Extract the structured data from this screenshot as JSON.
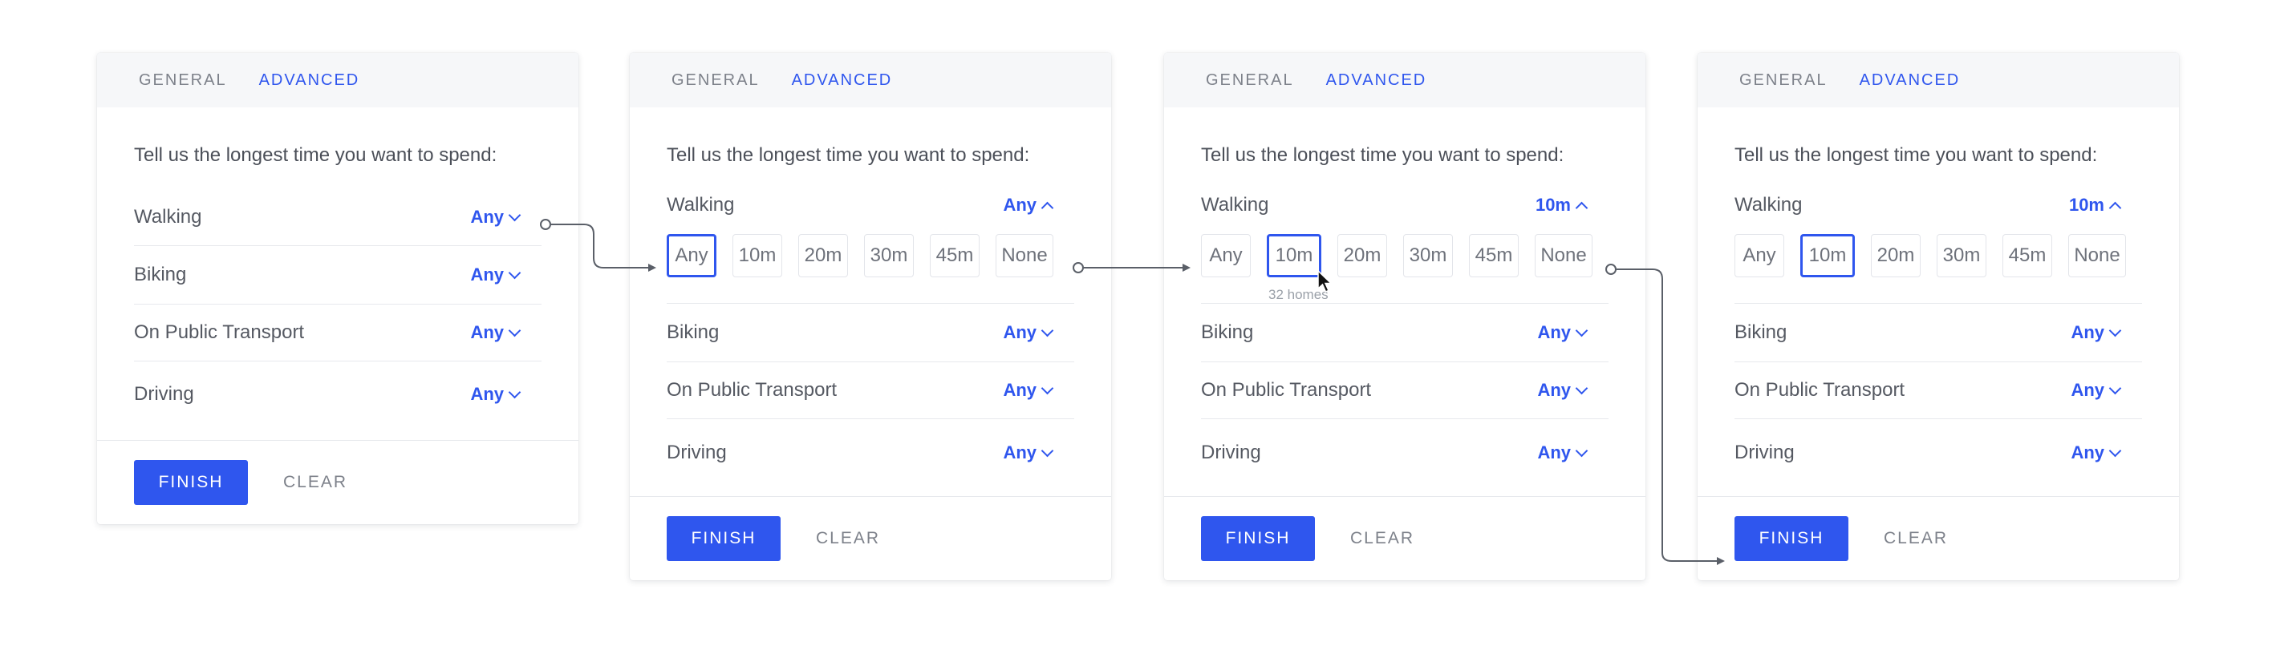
{
  "tabs": {
    "general": "GENERAL",
    "advanced": "ADVANCED"
  },
  "prompt": "Tell us the longest time you want to spend:",
  "modes": {
    "walking": "Walking",
    "biking": "Biking",
    "transport": "On Public Transport",
    "driving": "Driving"
  },
  "any": "Any",
  "ten": "10m",
  "options": [
    "Any",
    "10m",
    "20m",
    "30m",
    "45m",
    "None"
  ],
  "tooltip": "32 homes",
  "footer": {
    "finish": "FINISH",
    "clear": "CLEAR"
  },
  "colors": {
    "accent": "#2f56ee",
    "text": "#4b4f58",
    "muted": "#7d818a",
    "tab_bg": "#f6f7f9"
  }
}
